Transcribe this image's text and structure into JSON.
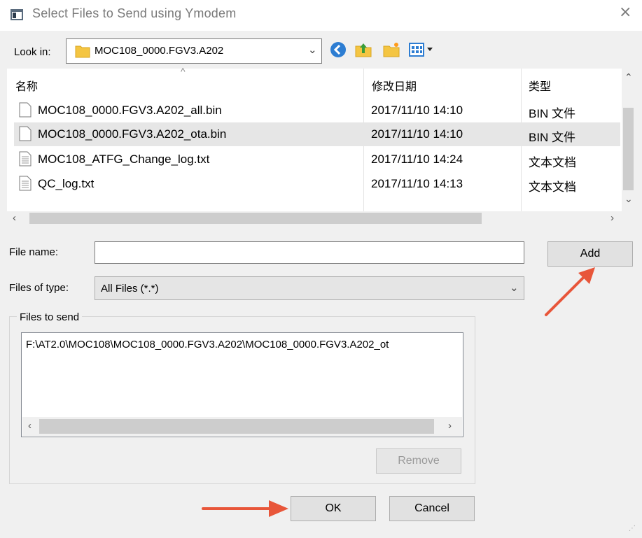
{
  "window": {
    "title": "Select Files to Send using Ymodem",
    "close_glyph": "×"
  },
  "look_in": {
    "label": "Look in:",
    "value": "MOC108_0000.FGV3.A202"
  },
  "toolbar": {
    "icons": [
      "back-icon",
      "up-folder-icon",
      "new-folder-icon",
      "view-menu-icon"
    ]
  },
  "file_list": {
    "columns": [
      "名称",
      "修改日期",
      "类型"
    ],
    "rows": [
      {
        "name": "MOC108_0000.FGV3.A202_all.bin",
        "date": "2017/11/10 14:10",
        "type": "BIN 文件",
        "icon": "file-icon",
        "selected": false
      },
      {
        "name": "MOC108_0000.FGV3.A202_ota.bin",
        "date": "2017/11/10 14:10",
        "type": "BIN 文件",
        "icon": "file-icon",
        "selected": true
      },
      {
        "name": "MOC108_ATFG_Change_log.txt",
        "date": "2017/11/10 14:24",
        "type": "文本文档",
        "icon": "text-file-icon",
        "selected": false
      },
      {
        "name": "QC_log.txt",
        "date": "2017/11/10 14:13",
        "type": "文本文档",
        "icon": "text-file-icon",
        "selected": false
      }
    ]
  },
  "file_name": {
    "label": "File name:",
    "value": "",
    "placeholder": ""
  },
  "file_type": {
    "label": "Files of type:",
    "value": "All Files (*.*)"
  },
  "buttons": {
    "add": "Add",
    "remove": "Remove",
    "ok": "OK",
    "cancel": "Cancel"
  },
  "files_to_send": {
    "label": "Files to send",
    "items": [
      "F:\\AT2.0\\MOC108\\MOC108_0000.FGV3.A202\\MOC108_0000.FGV3.A202_ot"
    ]
  },
  "colors": {
    "annotation_arrow": "#e8563a",
    "selected_row": "#e6e6e6",
    "folder": "#f4c542"
  }
}
